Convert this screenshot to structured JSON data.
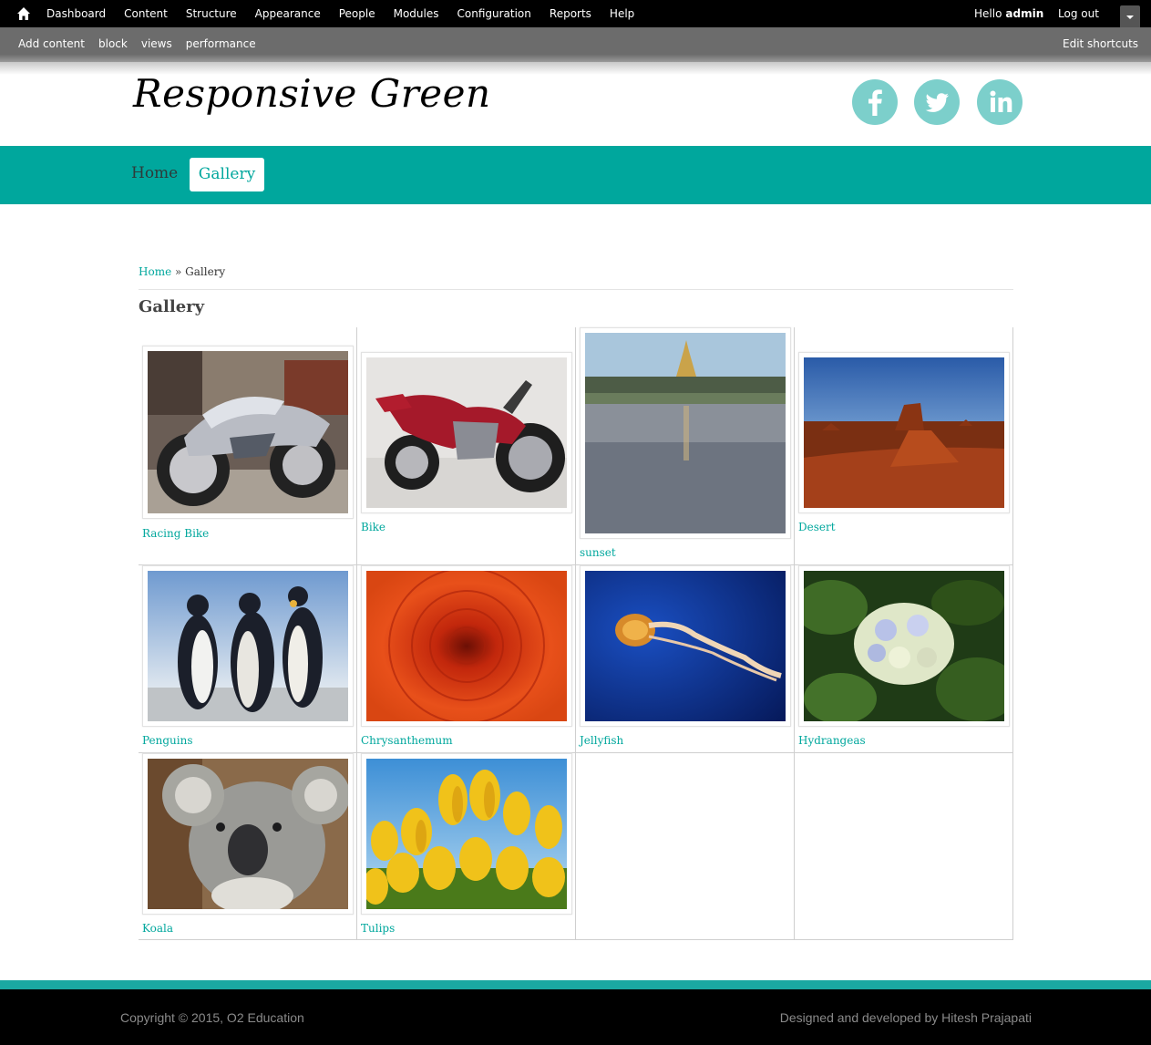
{
  "toolbar": {
    "menu": [
      "Dashboard",
      "Content",
      "Structure",
      "Appearance",
      "People",
      "Modules",
      "Configuration",
      "Reports",
      "Help"
    ],
    "hello": "Hello",
    "user": "admin",
    "logout": "Log out",
    "shortcuts": [
      "Add content",
      "block",
      "views",
      "performance"
    ],
    "edit_shortcuts": "Edit shortcuts"
  },
  "site": {
    "logo": "Responsive Green",
    "social": [
      "facebook-icon",
      "twitter-icon",
      "linkedin-icon"
    ]
  },
  "nav": {
    "home": "Home",
    "gallery": "Gallery"
  },
  "breadcrumb": {
    "home": "Home",
    "separator": "»",
    "current": "Gallery"
  },
  "page_title": "Gallery",
  "gallery": [
    {
      "caption": "Racing Bike",
      "image": "silver chopper motorcycle"
    },
    {
      "caption": "Bike",
      "image": "red custom motorcycle"
    },
    {
      "caption": "sunset",
      "image": "golden pagoda over lake"
    },
    {
      "caption": "Desert",
      "image": "red rock desert mesa"
    },
    {
      "caption": "Penguins",
      "image": "three emperor penguins"
    },
    {
      "caption": "Chrysanthemum",
      "image": "red orange chrysanthemum flower"
    },
    {
      "caption": "Jellyfish",
      "image": "orange jellyfish in blue water"
    },
    {
      "caption": "Hydrangeas",
      "image": "white blue hydrangeas"
    },
    {
      "caption": "Koala",
      "image": "koala portrait"
    },
    {
      "caption": "Tulips",
      "image": "yellow tulips against sky"
    }
  ],
  "footer": {
    "copyright": "Copyright © 2015, O2 Education",
    "credit": "Designed and developed by Hitesh Prajapati"
  },
  "colors": {
    "accent": "#00a79d",
    "social": "#7ccfcb",
    "toolbar": "#000000"
  }
}
